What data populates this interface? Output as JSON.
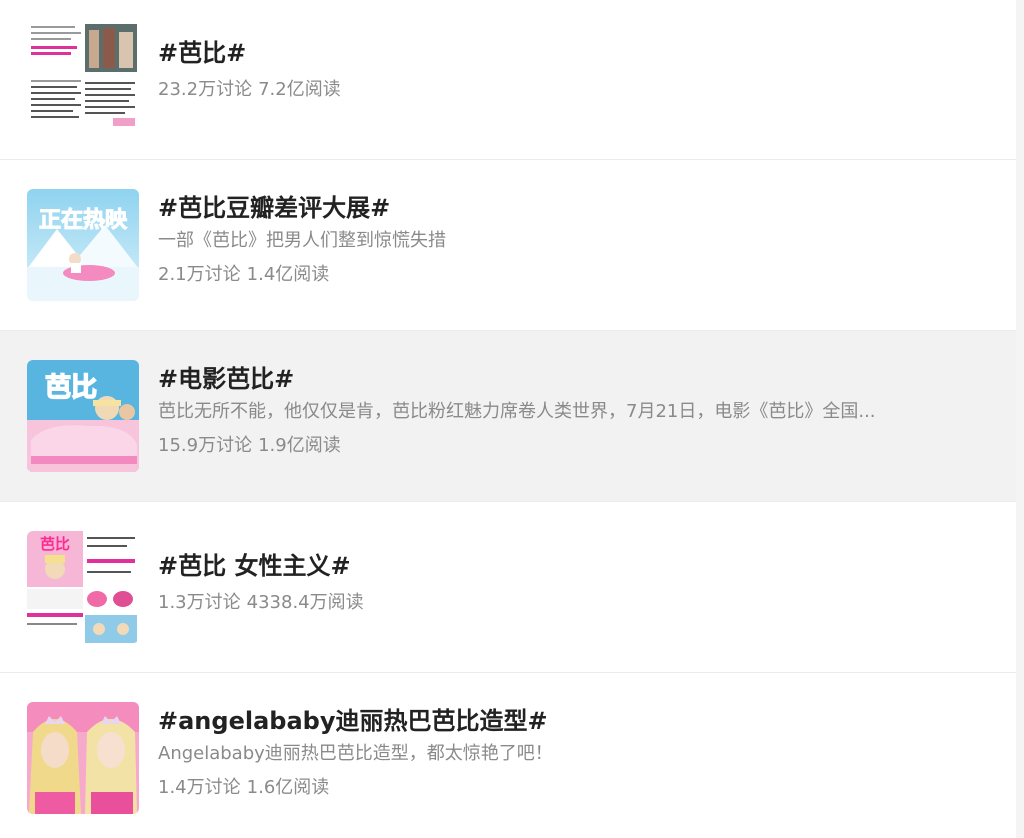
{
  "topics": [
    {
      "title": "#芭比#",
      "description": "",
      "discussions": "23.2万讨论",
      "reads": "7.2亿阅读",
      "thumb_icon": "news-collage-image"
    },
    {
      "title": "#芭比豆瓣差评大展#",
      "description": "一部《芭比》把男人们整到惊慌失措",
      "discussions": "2.1万讨论",
      "reads": "1.4亿阅读",
      "thumb_icon": "snow-movie-poster-image",
      "thumb_text": "正在热映"
    },
    {
      "title": "#电影芭比#",
      "description": "芭比无所不能，他仅仅是肯，芭比粉红魅力席卷人类世界，7月21日，电影《芭比》全国...",
      "discussions": "15.9万讨论",
      "reads": "1.9亿阅读",
      "thumb_icon": "pink-car-poster-image",
      "thumb_text": "芭比"
    },
    {
      "title": "#芭比 女性主义#",
      "description": "",
      "discussions": "1.3万讨论",
      "reads": "4338.4万阅读",
      "thumb_icon": "pink-collage-image",
      "thumb_text": "芭比"
    },
    {
      "title": "#angelababy迪丽热巴芭比造型#",
      "description": "Angelababy迪丽热巴芭比造型，都太惊艳了吧！",
      "discussions": "1.4万讨论",
      "reads": "1.6亿阅读",
      "thumb_icon": "two-blonde-portraits-image"
    }
  ]
}
